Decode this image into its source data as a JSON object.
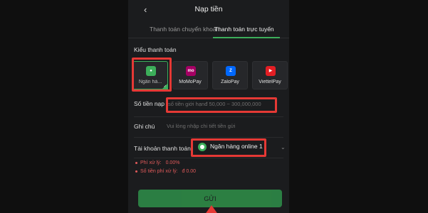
{
  "header": {
    "back_icon": "chevron-left-icon",
    "title": "Nạp tiền"
  },
  "tabs": [
    {
      "label": "Thanh toán chuyển khoản",
      "active": false
    },
    {
      "label": "Thanh toán trực tuyến",
      "active": true
    }
  ],
  "payment_type": {
    "label": "Kiểu thanh toán",
    "methods": [
      {
        "label": "Ngân hà...",
        "icon": "bank-online-icon",
        "selected": true,
        "color": "#3cae5a"
      },
      {
        "label": "MoMoPay",
        "icon": "momo-icon",
        "selected": false,
        "color": "#a50064"
      },
      {
        "label": "ZaloPay",
        "icon": "zalopay-icon",
        "selected": false,
        "color": "#0068ff"
      },
      {
        "label": "ViettelPay",
        "icon": "viettelpay-icon",
        "selected": false,
        "color": "#e31e24"
      }
    ]
  },
  "amount": {
    "label": "Số tiền nạp",
    "placeholder": "số tiền giới hạnđ 50,000 ~ 300,000,000"
  },
  "note": {
    "label": "Ghi chú",
    "placeholder": "Vui lòng nhập chi tiết tiền gửi"
  },
  "account": {
    "label": "Tài khoản thanh toán",
    "value": "Ngân hàng online 1"
  },
  "fees": [
    {
      "label": "Phí xử lý:",
      "value": "0.00%"
    },
    {
      "label": "Số tiền phí xử lý:",
      "value": "đ 0.00"
    }
  ],
  "submit_label": "GỬI",
  "accent_color": "#3cae5a",
  "highlight_color": "#e53935"
}
